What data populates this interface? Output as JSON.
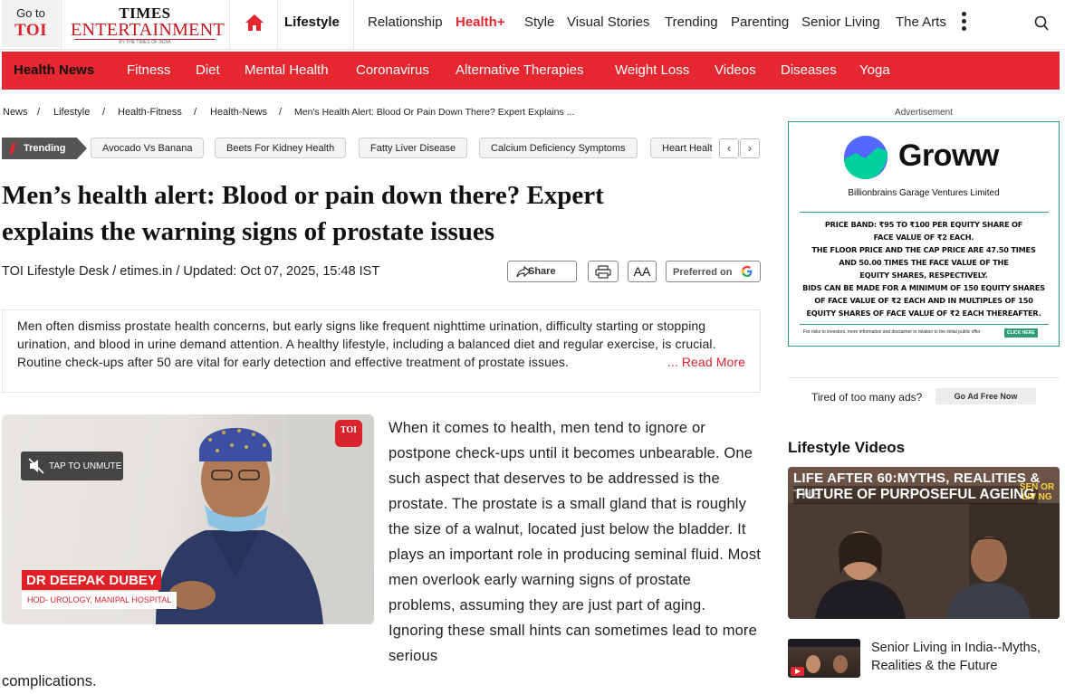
{
  "header": {
    "goto_line1": "Go to",
    "goto_line2": "TOI",
    "brand_line1": "TIMES",
    "brand_line2": "ENTERTAINMENT",
    "brand_line3": "BY THE TIMES OF INDIA",
    "section": "Lifestyle",
    "nav": [
      "Relationship",
      "Health+",
      "Style",
      "Visual Stories",
      "Trending",
      "Parenting",
      "Senior Living",
      "The Arts"
    ],
    "active_color": "#e5282f"
  },
  "subnav": {
    "items": [
      "Health News",
      "Fitness",
      "Diet",
      "Mental Health",
      "Coronavirus",
      "Alternative Therapies",
      "Weight Loss",
      "Videos",
      "Diseases",
      "Yoga"
    ],
    "bg_color": "#e5282f"
  },
  "breadcrumb": [
    "News",
    "Lifestyle",
    "Health-Fitness",
    "Health-News",
    "Men's Health Alert: Blood Or Pain Down There? Expert Explains ..."
  ],
  "trending": {
    "label": "Trending",
    "pills": [
      "Avocado Vs Banana",
      "Beets For Kidney Health",
      "Fatty Liver Disease",
      "Calcium Deficiency Symptoms",
      "Heart Health"
    ]
  },
  "article": {
    "headline_line1": "Men’s health alert: Blood or pain down there? Expert",
    "headline_line2": "explains the warning signs of prostate issues",
    "byline": "TOI Lifestyle Desk / etimes.in / Updated: Oct 07, 2025, 15:48 IST",
    "share_label": "Share",
    "font_label": "AA",
    "preferred_label": "Preferred on",
    "summary": "Men often dismiss prostate health concerns, but early signs like frequent nighttime urination, difficulty starting or stopping urination, and blood in urine demand attention. A healthy lifestyle, including a balanced diet and regular exercise, is crucial. Routine check-ups after 50 are vital for early detection and effective treatment of prostate issues.",
    "read_more": "... Read More",
    "body": "When it comes to health, men tend to ignore or postpone check-ups until it becomes unbearable. One such aspect that deserves to be addressed is the prostate. The prostate is a small gland that is roughly the size of a walnut, located just below the bladder. It plays an important role in producing seminal fluid. Most men overlook early warning signs of prostate problems, assuming they are just part of aging. Ignoring these small hints can sometimes lead to more serious",
    "body_cont": "complications."
  },
  "video": {
    "unmute_label": "TAP TO UNMUTE",
    "logo_text": "TOI",
    "speaker_name": "DR DEEPAK DUBEY",
    "speaker_title": "HOD- UROLOGY, MANIPAL HOSPITAL"
  },
  "ad": {
    "label": "Advertisement",
    "brand": "Groww",
    "company": "Billionbrains Garage Ventures Limited",
    "lines": [
      "PRICE BAND: ₹95 TO  ₹100 PER EQUITY SHARE OF",
      "FACE VALUE OF ₹2 EACH.",
      "THE FLOOR PRICE AND THE CAP PRICE ARE 47.50 TIMES",
      "AND 50.00 TIMES THE FACE VALUE OF THE",
      "EQUITY SHARES, RESPECTIVELY.",
      "BIDS CAN BE MADE FOR A MINIMUM OF 150 EQUITY SHARES",
      "OF FACE VALUE OF ₹2 EACH AND IN MULTIPLES OF 150",
      "EQUITY SHARES OF FACE VALUE OF ₹2 EACH THEREAFTER."
    ],
    "footer": "For risks to investors, more information and disclaimer in relation to the initial public offer",
    "click_here": "CLICK HERE",
    "accent_color": "#2f9d77",
    "tired_text": "Tired of too many ads?",
    "ad_free_label": "Go Ad Free Now"
  },
  "lifestyle_videos": {
    "heading": "Lifestyle Videos",
    "featured_title_line1": "LIFE AFTER 60:MYTHS, REALITIES & THE",
    "featured_title_line2": "FUTURE OF PURPOSEFUL AGEING",
    "featured_badge": "SEN OR LIV NG",
    "item_title": "Senior Living in India--Myths, Realities & the Future"
  }
}
